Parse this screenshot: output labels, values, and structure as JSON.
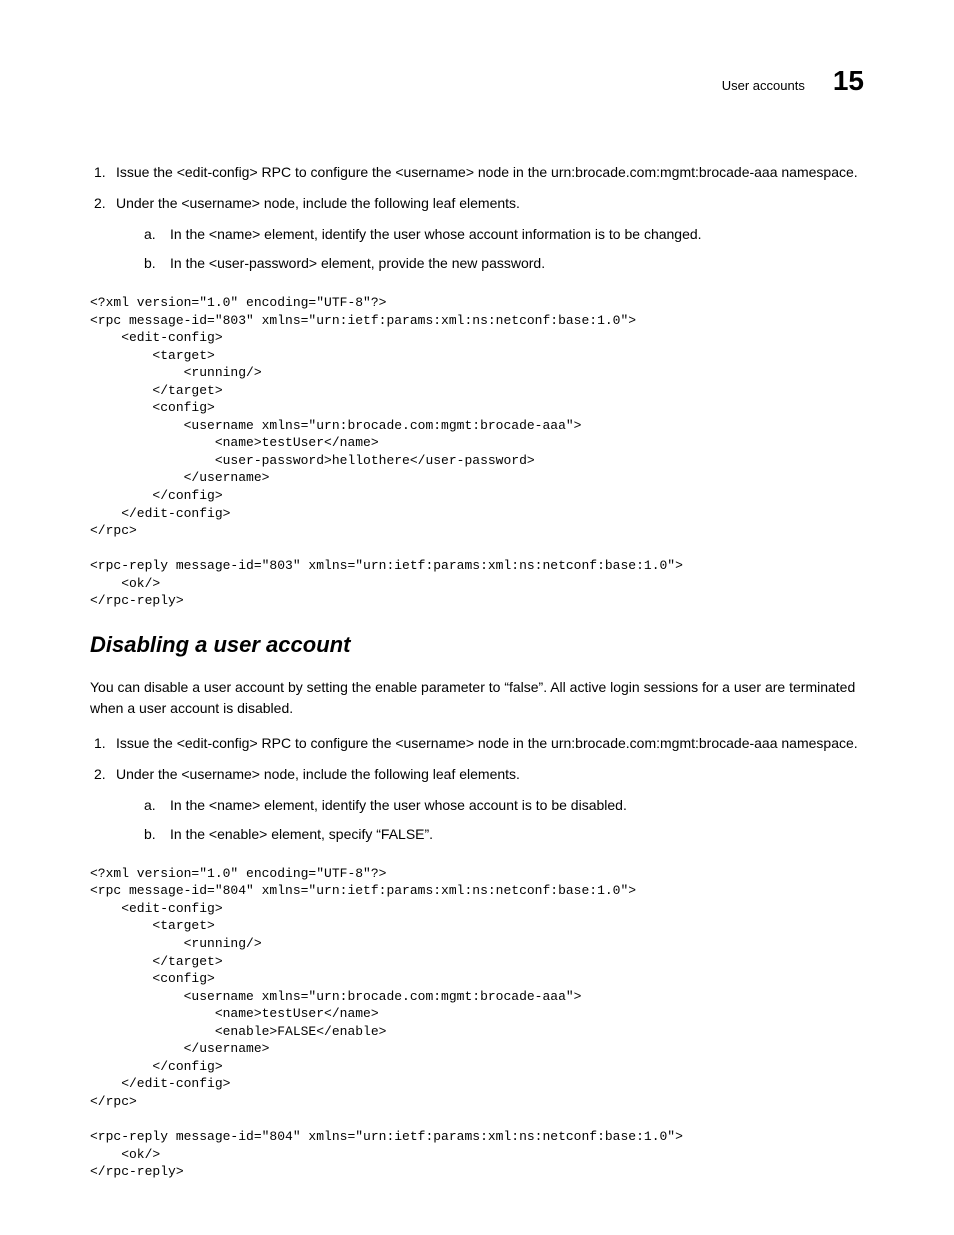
{
  "header": {
    "title": "User accounts",
    "chapter": "15"
  },
  "sec1": {
    "step1": {
      "num": "1.",
      "text": "Issue the <edit-config> RPC to configure the <username> node in the urn:brocade.com:mgmt:brocade-aaa namespace."
    },
    "step2": {
      "num": "2.",
      "text": "Under the <username> node, include the following leaf elements.",
      "a": {
        "num": "a.",
        "text": "In the <name> element, identify the user whose account information is to be changed."
      },
      "b": {
        "num": "b.",
        "text": "In the <user-password> element, provide the new password."
      }
    },
    "code": "<?xml version=\"1.0\" encoding=\"UTF-8\"?>\n<rpc message-id=\"803\" xmlns=\"urn:ietf:params:xml:ns:netconf:base:1.0\">\n    <edit-config>\n        <target>\n            <running/>\n        </target>\n        <config>\n            <username xmlns=\"urn:brocade.com:mgmt:brocade-aaa\">\n                <name>testUser</name>\n                <user-password>hellothere</user-password>\n            </username>\n        </config>\n    </edit-config>\n</rpc>\n\n<rpc-reply message-id=\"803\" xmlns=\"urn:ietf:params:xml:ns:netconf:base:1.0\">\n    <ok/>\n</rpc-reply>"
  },
  "sec2": {
    "heading": "Disabling a user account",
    "intro": "You can disable a user account by setting the enable parameter to “false”. All active login sessions for a user are terminated when a user account is disabled.",
    "step1": {
      "num": "1.",
      "text": "Issue the <edit-config> RPC to configure the <username> node in the urn:brocade.com:mgmt:brocade-aaa namespace."
    },
    "step2": {
      "num": "2.",
      "text": "Under the <username> node, include the following leaf elements.",
      "a": {
        "num": "a.",
        "text": "In the <name> element, identify the user whose account is to be disabled."
      },
      "b": {
        "num": "b.",
        "text": "In the <enable> element, specify “FALSE”."
      }
    },
    "code": "<?xml version=\"1.0\" encoding=\"UTF-8\"?>\n<rpc message-id=\"804\" xmlns=\"urn:ietf:params:xml:ns:netconf:base:1.0\">\n    <edit-config>\n        <target>\n            <running/>\n        </target>\n        <config>\n            <username xmlns=\"urn:brocade.com:mgmt:brocade-aaa\">\n                <name>testUser</name>\n                <enable>FALSE</enable>\n            </username>\n        </config>\n    </edit-config>\n</rpc>\n\n<rpc-reply message-id=\"804\" xmlns=\"urn:ietf:params:xml:ns:netconf:base:1.0\">\n    <ok/>\n</rpc-reply>"
  }
}
